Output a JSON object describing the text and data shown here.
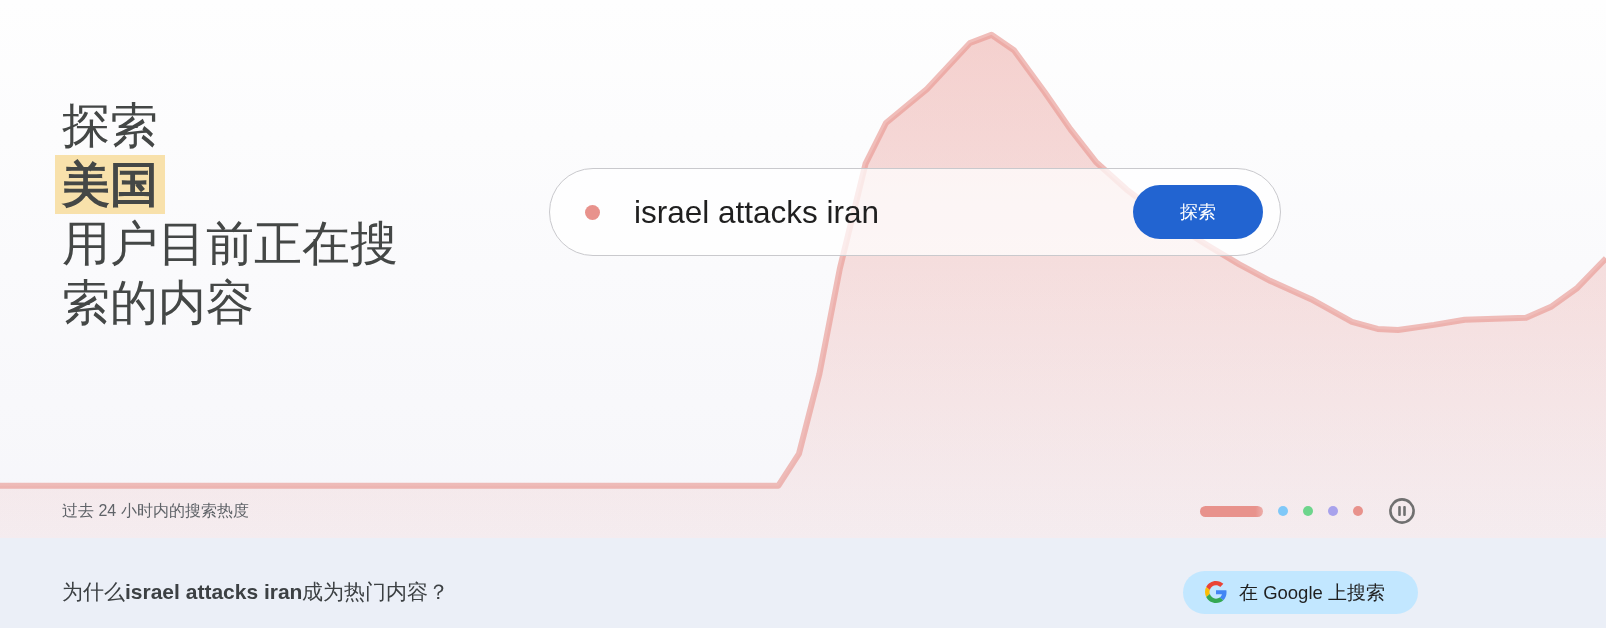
{
  "hero": {
    "title": "探索**美国**用户目前正在搜索的内容",
    "search": {
      "value": "israel attacks iran",
      "button": "探索"
    },
    "caption": "过去 24 小时内的搜索热度",
    "slides": [
      {
        "color": "#e8928c",
        "selected": true
      },
      {
        "color": "#7fc8f8",
        "selected": false
      },
      {
        "color": "#6dd58c",
        "selected": false
      },
      {
        "color": "#a8a2ec",
        "selected": false
      },
      {
        "color": "#e8928c",
        "selected": false
      }
    ]
  },
  "explainer": {
    "question": "为什么**israel attacks iran**成为热门内容？",
    "button": "在 Google 上搜索"
  }
}
